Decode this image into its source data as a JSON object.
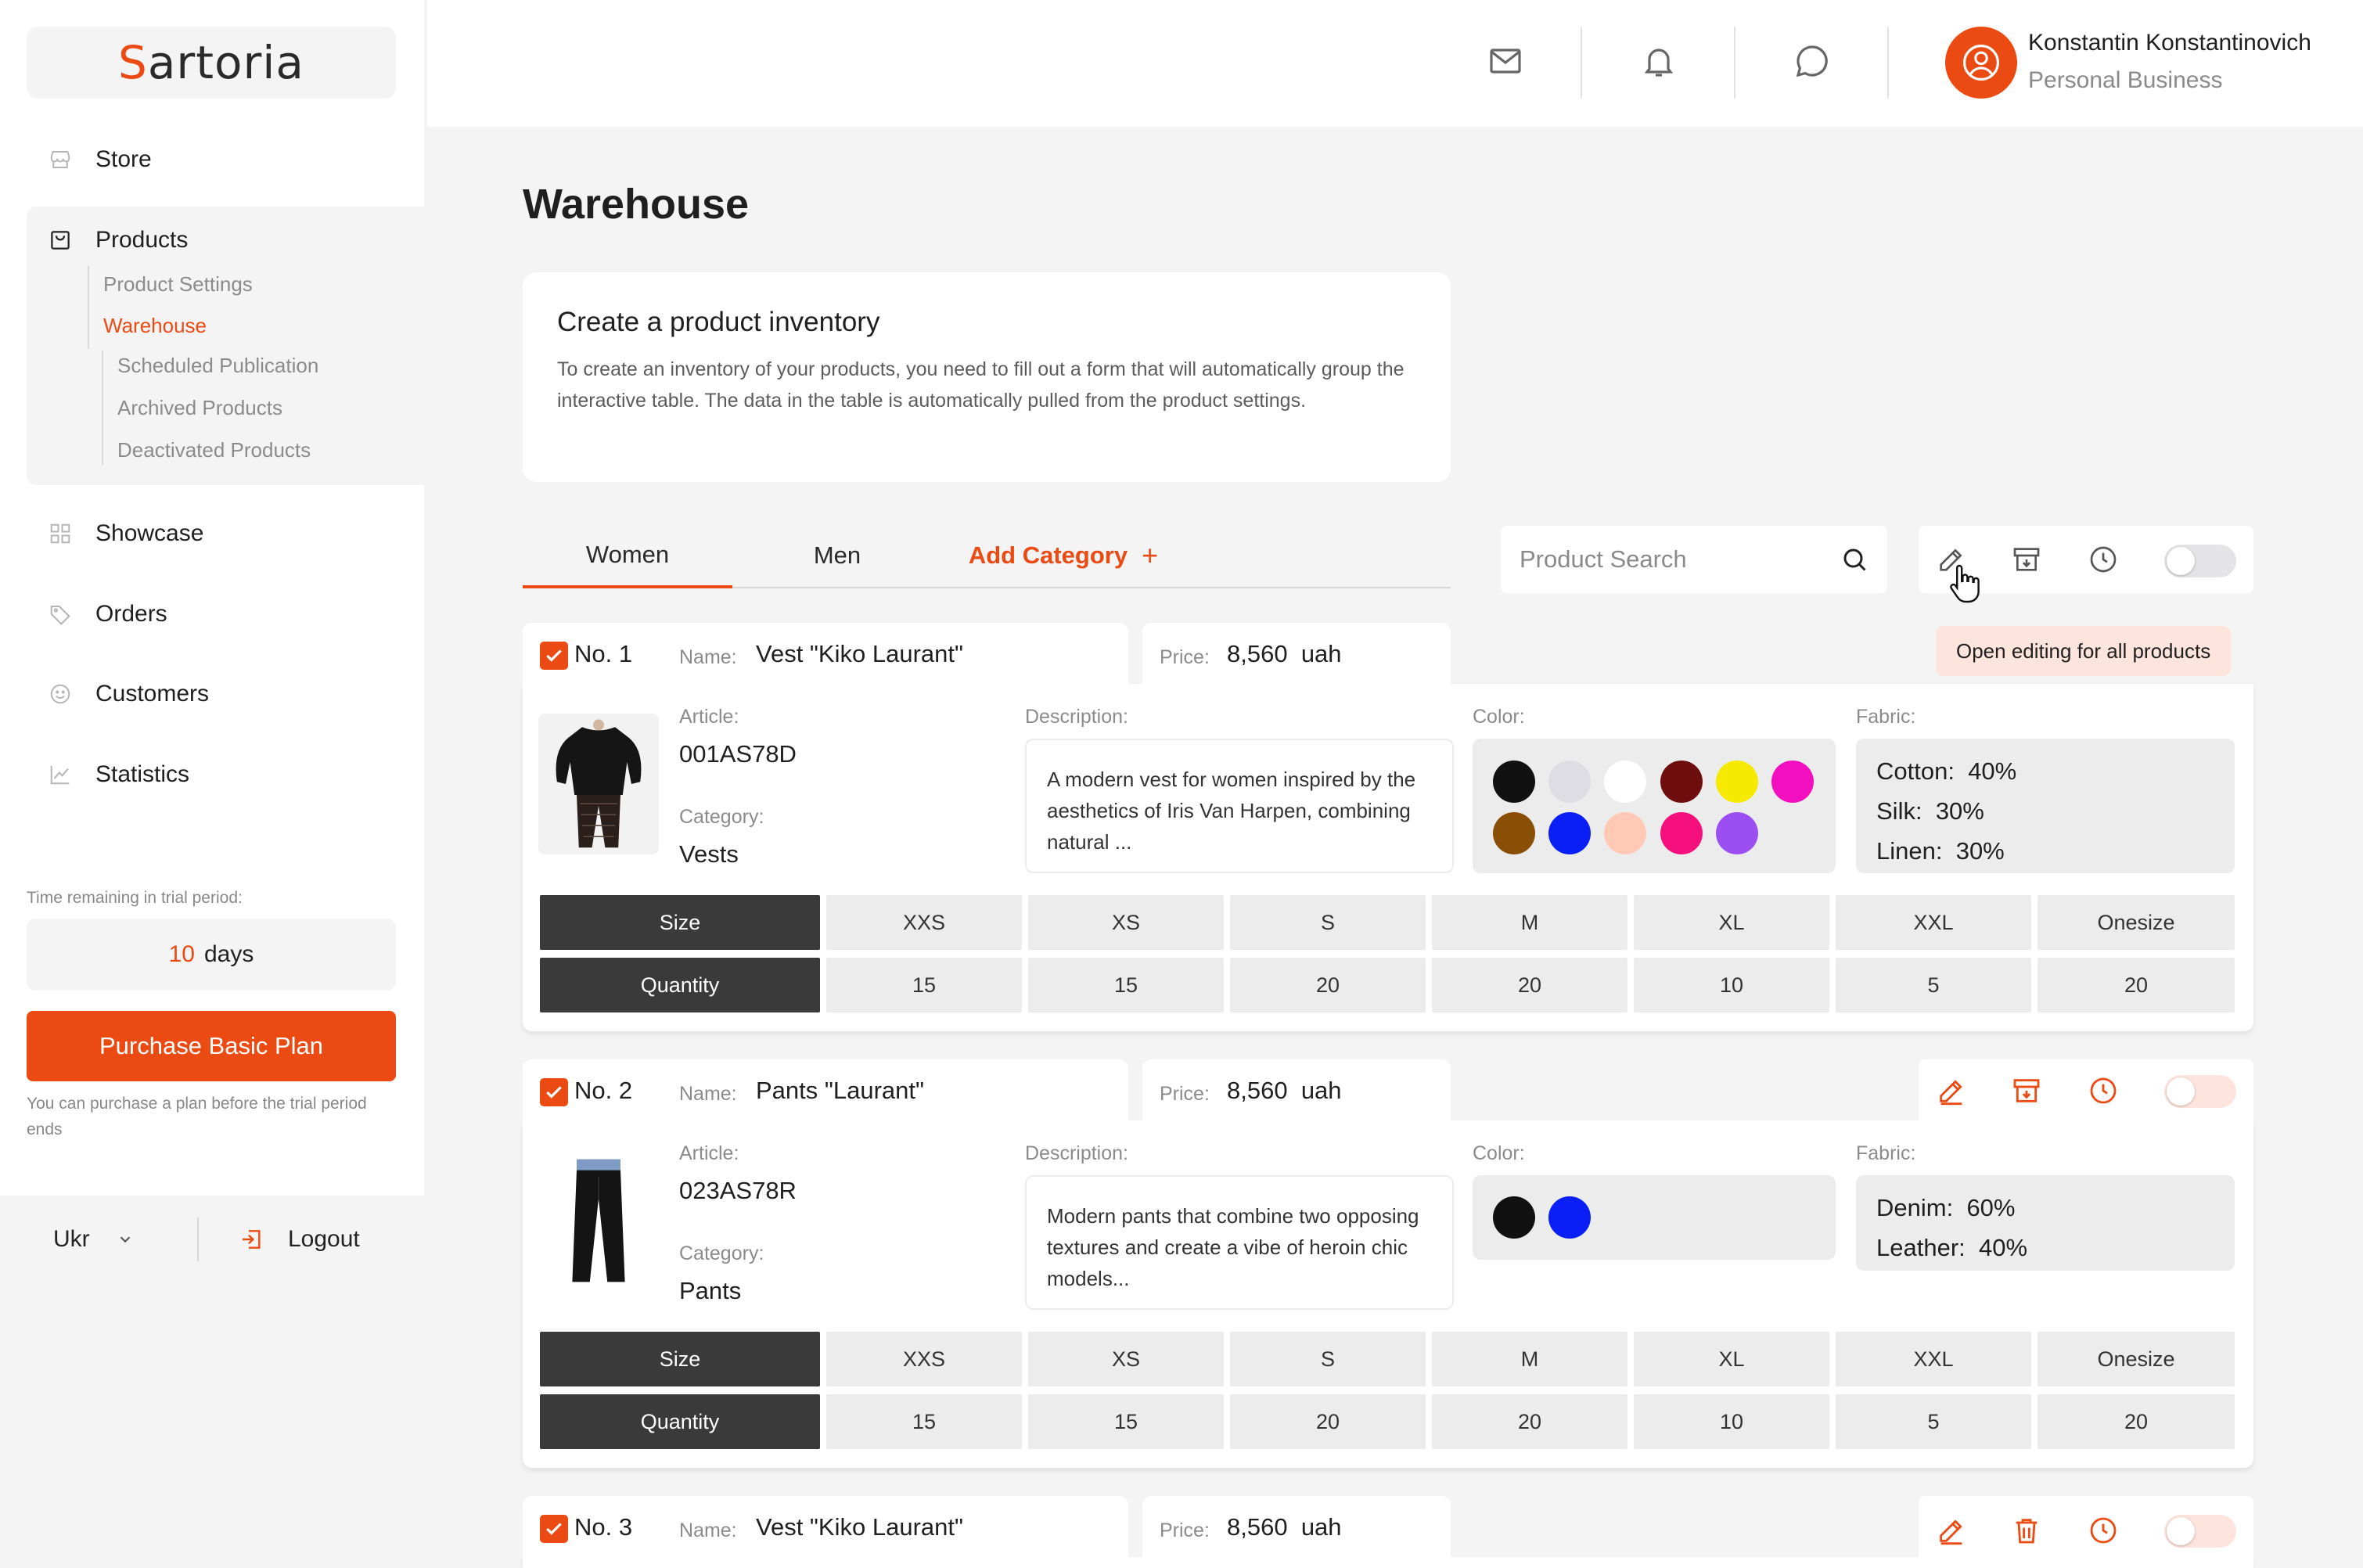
{
  "brand": {
    "logo_text_first": "S",
    "logo_text_rest": "artoria",
    "accent": "#ec4a13"
  },
  "sidebar": {
    "nav": [
      {
        "label": "Store",
        "icon": "store-icon"
      },
      {
        "label": "Products",
        "icon": "bag-icon"
      },
      {
        "label": "Showcase",
        "icon": "grid-icon"
      },
      {
        "label": "Orders",
        "icon": "tag-icon"
      },
      {
        "label": "Customers",
        "icon": "smile-icon"
      },
      {
        "label": "Statistics",
        "icon": "chart-icon"
      }
    ],
    "products_sub": [
      "Product Settings",
      "Warehouse"
    ],
    "warehouse_sub": [
      "Scheduled Publication",
      "Archived Products",
      "Deactivated Products"
    ],
    "trial_label": "Time remaining in trial period:",
    "trial_days": "10",
    "trial_unit": "days",
    "purchase_label": "Purchase Basic Plan",
    "purchase_note": "You can purchase a plan before the trial period ends",
    "language": "Ukr",
    "logout": "Logout"
  },
  "header": {
    "icons": [
      "mail-icon",
      "bell-icon",
      "chat-icon"
    ],
    "user_name": "Konstantin Konstantinovich",
    "user_sub": "Personal Business"
  },
  "main": {
    "title": "Warehouse",
    "info_title": "Create a product inventory",
    "info_text": "To create an inventory of your products, you need to fill out a form that will automatically group the interactive table. The data in the table is automatically pulled from the product settings.",
    "tabs": [
      "Women",
      "Men"
    ],
    "add_category": "Add Category",
    "add_plus": "+",
    "search_placeholder": "Product Search",
    "tooltip": "Open editing for all products"
  },
  "labels": {
    "name": "Name:",
    "price": "Price:",
    "article": "Article:",
    "category": "Category:",
    "description": "Description:",
    "color": "Color:",
    "fabric": "Fabric:",
    "size": "Size",
    "quantity": "Quantity"
  },
  "sizes": [
    "XXS",
    "XS",
    "S",
    "M",
    "XL",
    "XXL",
    "Onesize"
  ],
  "products": [
    {
      "no": "No. 1",
      "name": "Vest \"Kiko Laurant\"",
      "price": "8,560",
      "currency": "uah",
      "article": "001AS78D",
      "category": "Vests",
      "description": "A modern vest for women inspired by the aesthetics of Iris Van Harpen, combining natural ...",
      "colors": [
        "#111111",
        "#dedde3",
        "#ffffff",
        "#6e0e0e",
        "#f6ea00",
        "#f20fbf",
        "#8a4f06",
        "#0a1ff5",
        "#ffc9b5",
        "#f5107e",
        "#9b4ff2"
      ],
      "fabric": [
        {
          "label": "Cotton:",
          "value": "40%"
        },
        {
          "label": "Silk:",
          "value": "30%"
        },
        {
          "label": "Linen:",
          "value": "30%"
        }
      ],
      "quantities": [
        "15",
        "15",
        "20",
        "20",
        "10",
        "5",
        "20"
      ]
    },
    {
      "no": "No. 2",
      "name": "Pants \"Laurant\"",
      "price": "8,560",
      "currency": "uah",
      "article": "023AS78R",
      "category": "Pants",
      "description": "Modern pants that combine two opposing textures and create a vibe of heroin chic models...",
      "colors": [
        "#111111",
        "#0a1ff5"
      ],
      "fabric": [
        {
          "label": "Denim:",
          "value": "60%"
        },
        {
          "label": "Leather:",
          "value": "40%"
        }
      ],
      "quantities": [
        "15",
        "15",
        "20",
        "20",
        "10",
        "5",
        "20"
      ]
    },
    {
      "no": "No. 3",
      "name": "Vest \"Kiko Laurant\"",
      "price": "8,560",
      "currency": "uah"
    }
  ]
}
